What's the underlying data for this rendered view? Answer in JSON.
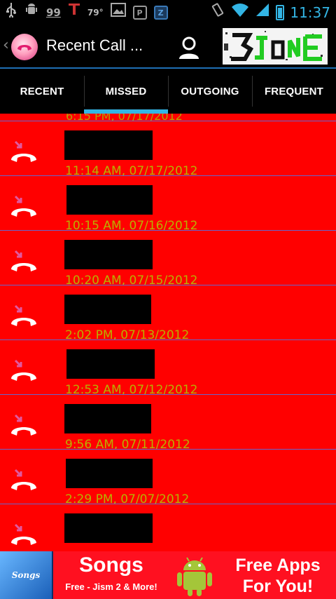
{
  "status_bar": {
    "signal_number": "99",
    "temperature": "79°",
    "z_badge": "Z",
    "p_badge": "P",
    "time": "11:37",
    "colors": {
      "accent": "#33b5e5"
    }
  },
  "action_bar": {
    "title": "Recent Call ..."
  },
  "tabs": [
    {
      "label": "RECENT",
      "active": false
    },
    {
      "label": "MISSED",
      "active": true
    },
    {
      "label": "OUTGOING",
      "active": false
    },
    {
      "label": "FREQUENT",
      "active": false
    }
  ],
  "calls": {
    "cutoff_time": "6:15 PM, 07/17/2012",
    "items": [
      {
        "time": "11:14 AM, 07/17/2012",
        "icon": "missed-call-icon"
      },
      {
        "time": "10:15 AM, 07/16/2012",
        "icon": "missed-call-icon"
      },
      {
        "time": "10:20 AM, 07/15/2012",
        "icon": "missed-call-icon"
      },
      {
        "time": "2:02 PM, 07/13/2012",
        "icon": "missed-call-icon"
      },
      {
        "time": "12:53 AM, 07/12/2012",
        "icon": "missed-call-icon"
      },
      {
        "time": "9:56 AM, 07/11/2012",
        "icon": "missed-call-icon"
      },
      {
        "time": "2:29 PM, 07/07/2012",
        "icon": "missed-call-icon"
      },
      {
        "time": "",
        "icon": "missed-call-icon"
      }
    ]
  },
  "ad": {
    "icon_text": "Songs",
    "headline": "Songs",
    "subline": "Free - Jism 2 & More!",
    "cta_line1": "Free Apps",
    "cta_line2": "For You!"
  },
  "colors": {
    "list_background": "#ff0000",
    "time_text": "#b9b000",
    "divider": "#6666cc",
    "missed_icon_pink": "#e05aa0"
  }
}
